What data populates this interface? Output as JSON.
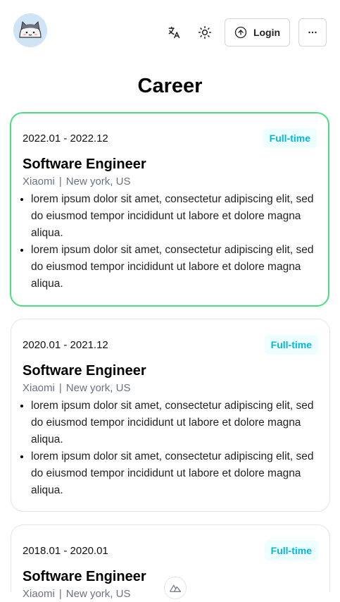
{
  "header": {
    "avatar_alt": "cat avatar",
    "icons": {
      "translate": "translate-icon",
      "theme": "sun-icon",
      "login": "arrow-up-circle-icon",
      "more": "more-horizontal-icon"
    },
    "login_label": "Login",
    "more_label": "···"
  },
  "page": {
    "title": "Career"
  },
  "cards": [
    {
      "date": "2022.01 - 2022.12",
      "badge": "Full-time",
      "role": "Software Engineer",
      "company": "Xiaomi",
      "separator": "|",
      "location": "New york, US",
      "points": [
        "lorem ipsum dolor sit amet, consectetur adipiscing elit, sed do eiusmod tempor incididunt ut labore et dolore magna aliqua.",
        "lorem ipsum dolor sit amet, consectetur adipiscing elit, sed do eiusmod tempor incididunt ut labore et dolore magna aliqua."
      ]
    },
    {
      "date": "2020.01 - 2021.12",
      "badge": "Full-time",
      "role": "Software Engineer",
      "company": "Xiaomi",
      "separator": "|",
      "location": "New york, US",
      "points": [
        "lorem ipsum dolor sit amet, consectetur adipiscing elit, sed do eiusmod tempor incididunt ut labore et dolore magna aliqua.",
        "lorem ipsum dolor sit amet, consectetur adipiscing elit, sed do eiusmod tempor incididunt ut labore et dolore magna aliqua."
      ]
    },
    {
      "date": "2018.01 - 2020.01",
      "badge": "Full-time",
      "role": "Software Engineer",
      "company": "Xiaomi",
      "separator": "|",
      "location": "New york, US"
    }
  ],
  "colors": {
    "active_border": "#4ade80",
    "badge_bg": "#ecfeff",
    "badge_text": "#06b6d4"
  }
}
